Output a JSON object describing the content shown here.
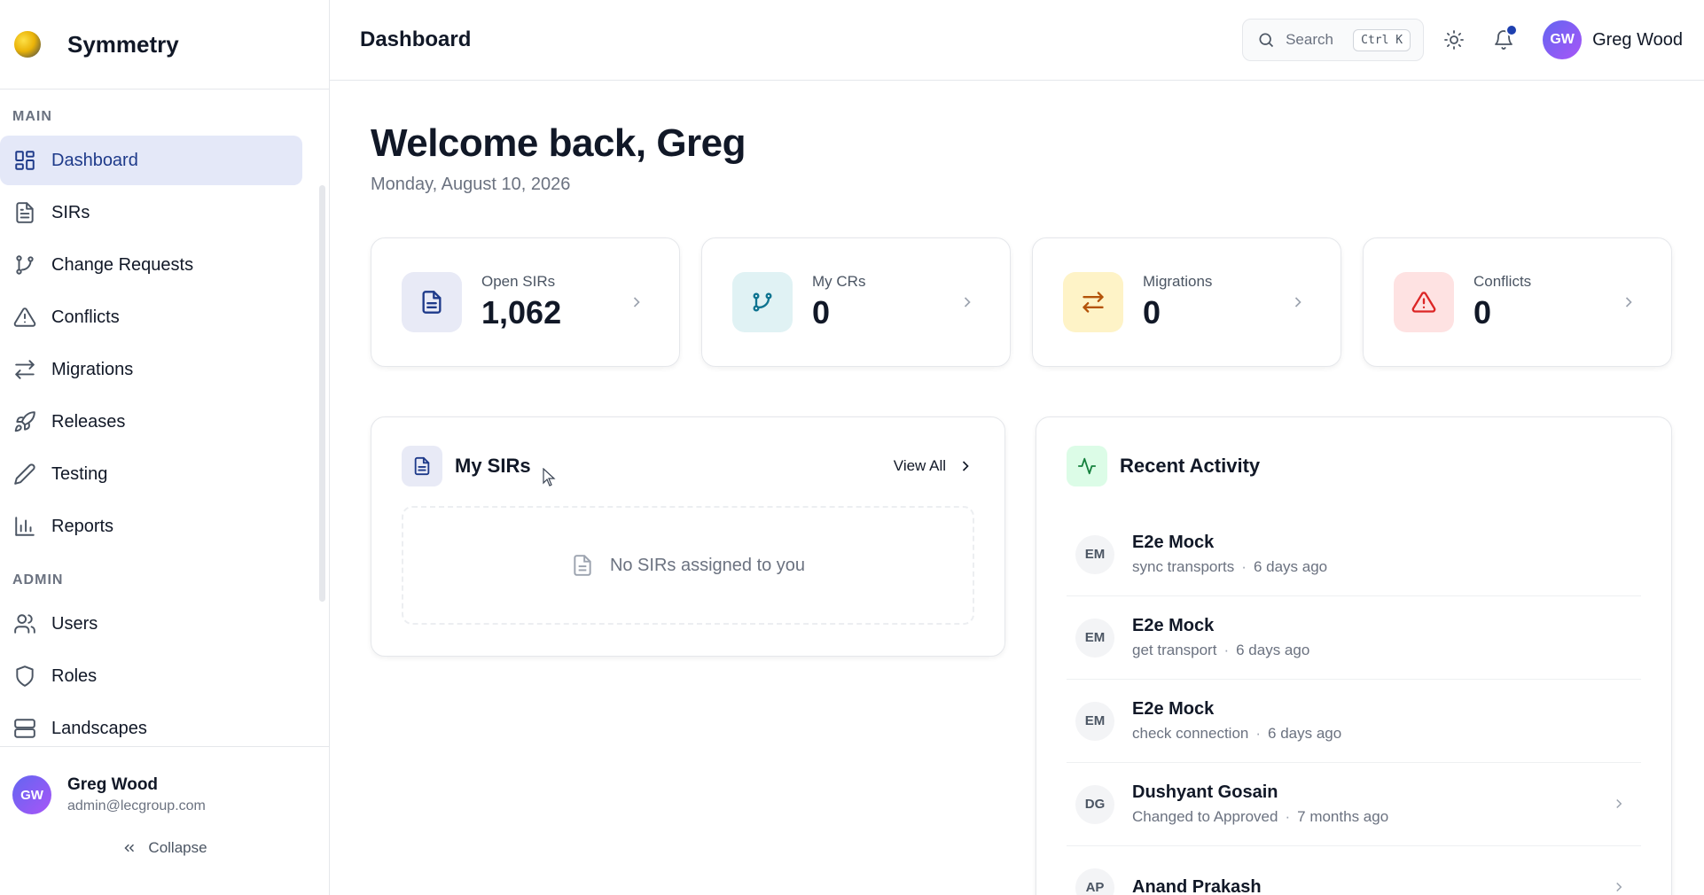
{
  "app": {
    "name": "Symmetry"
  },
  "sidebar": {
    "sections": [
      {
        "label": "MAIN",
        "items": [
          {
            "label": "Dashboard",
            "icon": "dashboard-grid-icon",
            "active": true
          },
          {
            "label": "SIRs",
            "icon": "document-icon"
          },
          {
            "label": "Change Requests",
            "icon": "git-branch-icon"
          },
          {
            "label": "Conflicts",
            "icon": "warning-triangle-icon"
          },
          {
            "label": "Migrations",
            "icon": "arrows-exchange-icon"
          },
          {
            "label": "Releases",
            "icon": "rocket-icon"
          },
          {
            "label": "Testing",
            "icon": "pencil-icon"
          },
          {
            "label": "Reports",
            "icon": "bar-chart-icon"
          }
        ]
      },
      {
        "label": "ADMIN",
        "items": [
          {
            "label": "Users",
            "icon": "users-icon"
          },
          {
            "label": "Roles",
            "icon": "shield-icon"
          },
          {
            "label": "Landscapes",
            "icon": "server-icon"
          }
        ]
      }
    ],
    "user": {
      "initials": "GW",
      "name": "Greg Wood",
      "email": "admin@lecgroup.com"
    },
    "collapse_label": "Collapse"
  },
  "topbar": {
    "title": "Dashboard",
    "search_label": "Search",
    "search_shortcut": "Ctrl K",
    "user_initials": "GW",
    "user_name": "Greg Wood"
  },
  "main": {
    "welcome": "Welcome back, Greg",
    "date": "Monday, August 10, 2026",
    "stats": [
      {
        "label": "Open SIRs",
        "value": "1,062",
        "icon": "document-icon",
        "bg": "#e8eaf6",
        "fg": "#1e3a8a"
      },
      {
        "label": "My CRs",
        "value": "0",
        "icon": "git-branch-icon",
        "bg": "#e0f2f4",
        "fg": "#0e7490"
      },
      {
        "label": "Migrations",
        "value": "0",
        "icon": "arrows-exchange-icon",
        "bg": "#fef3c7",
        "fg": "#b45309"
      },
      {
        "label": "Conflicts",
        "value": "0",
        "icon": "warning-triangle-icon",
        "bg": "#fee2e2",
        "fg": "#dc2626"
      }
    ],
    "my_sirs": {
      "title": "My SIRs",
      "view_all": "View All",
      "empty_text": "No SIRs assigned to you"
    },
    "recent_activity": {
      "title": "Recent Activity",
      "items": [
        {
          "initials": "EM",
          "name": "E2e Mock",
          "action": "sync transports",
          "time": "6 days ago",
          "chevron": false
        },
        {
          "initials": "EM",
          "name": "E2e Mock",
          "action": "get transport",
          "time": "6 days ago",
          "chevron": false
        },
        {
          "initials": "EM",
          "name": "E2e Mock",
          "action": "check connection",
          "time": "6 days ago",
          "chevron": false
        },
        {
          "initials": "DG",
          "name": "Dushyant Gosain",
          "action": "Changed to Approved",
          "time": "7 months ago",
          "chevron": true
        },
        {
          "initials": "AP",
          "name": "Anand Prakash",
          "action": "",
          "time": "",
          "chevron": true
        }
      ]
    }
  },
  "colors": {
    "active_bg": "#e4e8f8",
    "active_fg": "#1e3a8a",
    "notification_dot": "#1e40af",
    "activity_icon_bg": "#dcfce7",
    "activity_icon_fg": "#15803d"
  }
}
